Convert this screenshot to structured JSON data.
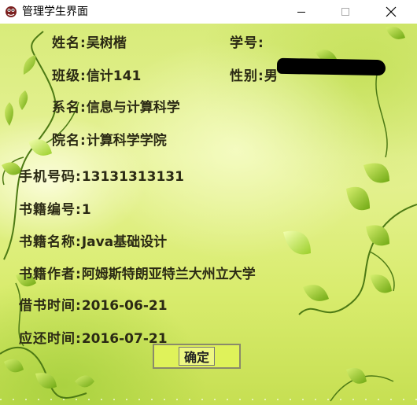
{
  "window": {
    "title": "管理学生界面"
  },
  "student": {
    "name_label": "姓名:",
    "name_value": "吴树楷",
    "id_label": "学号:",
    "class_label": "班级:",
    "class_value": "信计141",
    "gender_label": "性别:",
    "gender_value": "男",
    "dept_label": "系名:",
    "dept_value": "信息与计算科学",
    "college_label": "院名:",
    "college_value": "计算科学学院",
    "phone_label": "手机号码:",
    "phone_value": "13131313131"
  },
  "book": {
    "no_label": "书籍编号:",
    "no_value": "1",
    "title_label": "书籍名称:",
    "title_value": "Java基础设计",
    "author_label": "书籍作者:",
    "author_value": "阿姆斯特朗亚特兰大州立大学"
  },
  "loan": {
    "borrow_label": "借书时间:",
    "borrow_value": "2016-06-21",
    "due_label": "应还时间:",
    "due_value": "2016-07-21"
  },
  "actions": {
    "confirm_label": "确定"
  },
  "colors": {
    "text": "#2b2a14",
    "background": "#d9ec6e",
    "leaf": "#8fc21f"
  }
}
